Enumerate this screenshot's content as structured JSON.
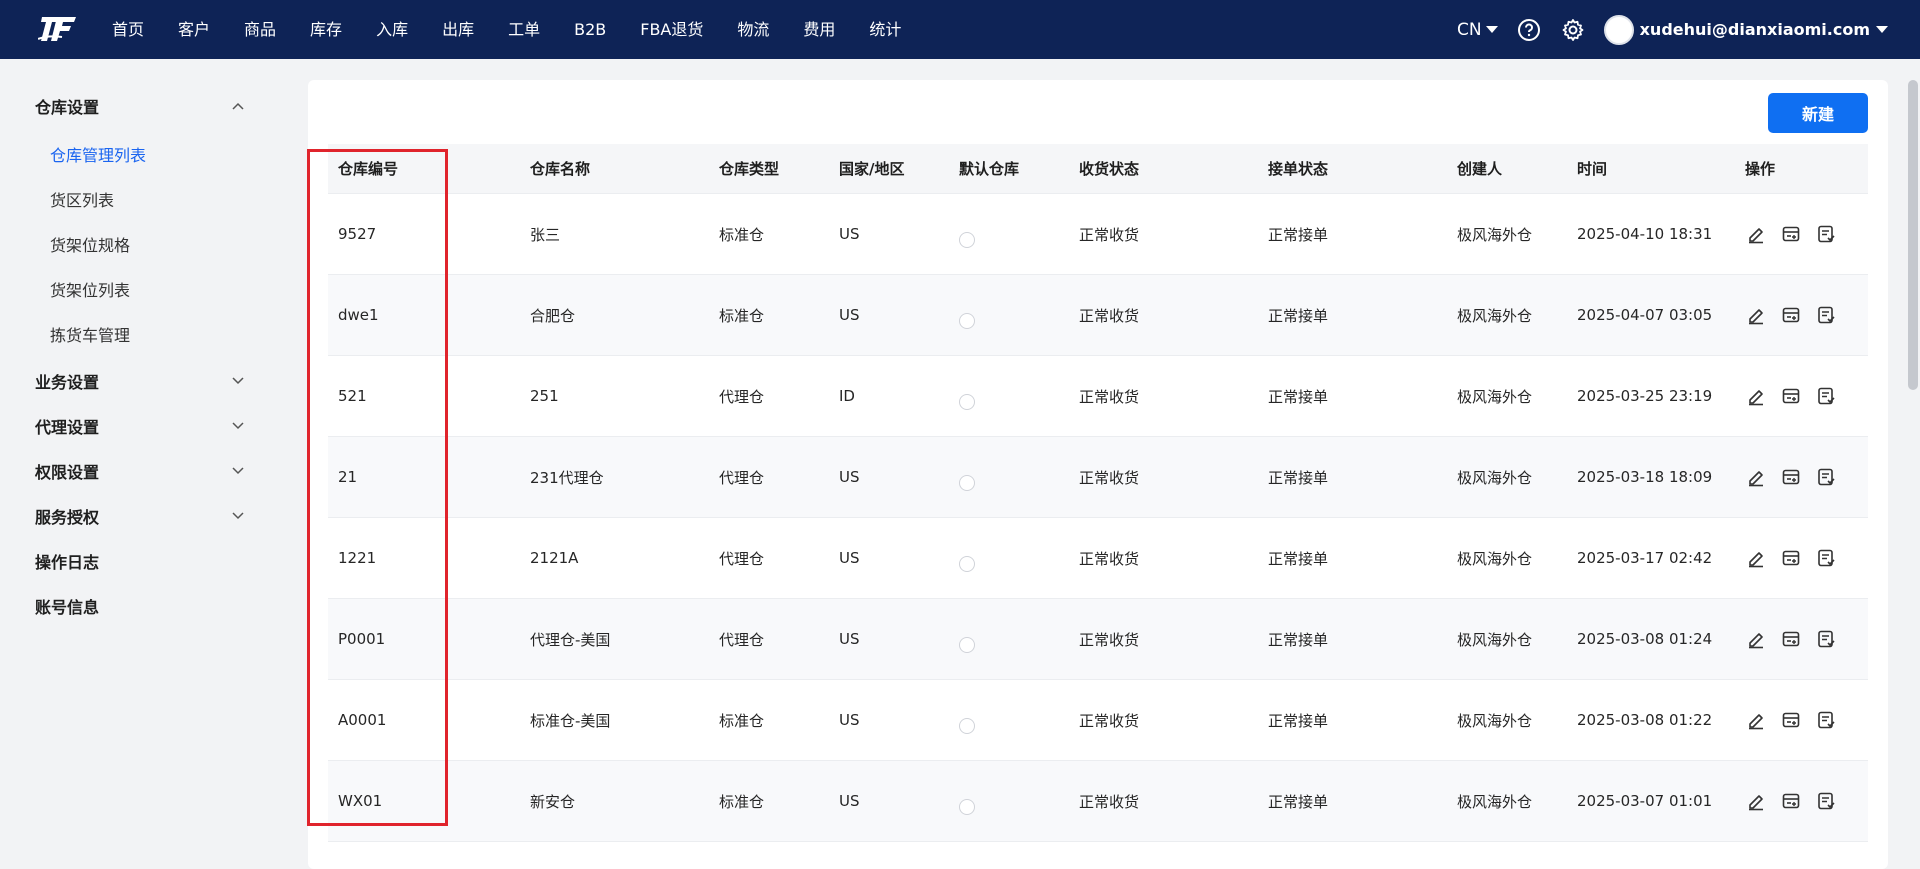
{
  "nav": {
    "menu": [
      "首页",
      "客户",
      "商品",
      "库存",
      "入库",
      "出库",
      "工单",
      "B2B",
      "FBA退货",
      "物流",
      "费用",
      "统计"
    ],
    "lang": "CN",
    "user": "xudehui@dianxiaomi.com"
  },
  "sidebar": {
    "warehouse_settings": "仓库设置",
    "items": [
      "仓库管理列表",
      "货区列表",
      "货架位规格",
      "货架位列表",
      "拣货车管理"
    ],
    "groups": [
      "业务设置",
      "代理设置",
      "权限设置",
      "服务授权"
    ],
    "operation_log": "操作日志",
    "account_info": "账号信息"
  },
  "toolbar": {
    "new_label": "新建"
  },
  "table": {
    "headers": [
      "仓库编号",
      "仓库名称",
      "仓库类型",
      "国家/地区",
      "默认仓库",
      "收货状态",
      "接单状态",
      "创建人",
      "时间",
      "操作"
    ],
    "rows": [
      [
        "9527",
        "张三",
        "标准仓",
        "US",
        "正常收货",
        "正常接单",
        "极风海外仓",
        "2025-04-10 18:31"
      ],
      [
        "dwe1",
        "合肥仓",
        "标准仓",
        "US",
        "正常收货",
        "正常接单",
        "极风海外仓",
        "2025-04-07 03:05"
      ],
      [
        "521",
        "251",
        "代理仓",
        "ID",
        "正常收货",
        "正常接单",
        "极风海外仓",
        "2025-03-25 23:19"
      ],
      [
        "21",
        "231代理仓",
        "代理仓",
        "US",
        "正常收货",
        "正常接单",
        "极风海外仓",
        "2025-03-18 18:09"
      ],
      [
        "1221",
        "2121A",
        "代理仓",
        "US",
        "正常收货",
        "正常接单",
        "极风海外仓",
        "2025-03-17 02:42"
      ],
      [
        "P0001",
        "代理仓-美国",
        "代理仓",
        "US",
        "正常收货",
        "正常接单",
        "极风海外仓",
        "2025-03-08 01:24"
      ],
      [
        "A0001",
        "标准仓-美国",
        "标准仓",
        "US",
        "正常收货",
        "正常接单",
        "极风海外仓",
        "2025-03-08 01:22"
      ],
      [
        "WX01",
        "新安仓",
        "标准仓",
        "US",
        "正常收货",
        "正常接单",
        "极风海外仓",
        "2025-03-07 01:01"
      ]
    ]
  },
  "colors": {
    "nav_bg": "#0e2356",
    "accent": "#0f6ff2",
    "highlight": "#e0242c"
  }
}
